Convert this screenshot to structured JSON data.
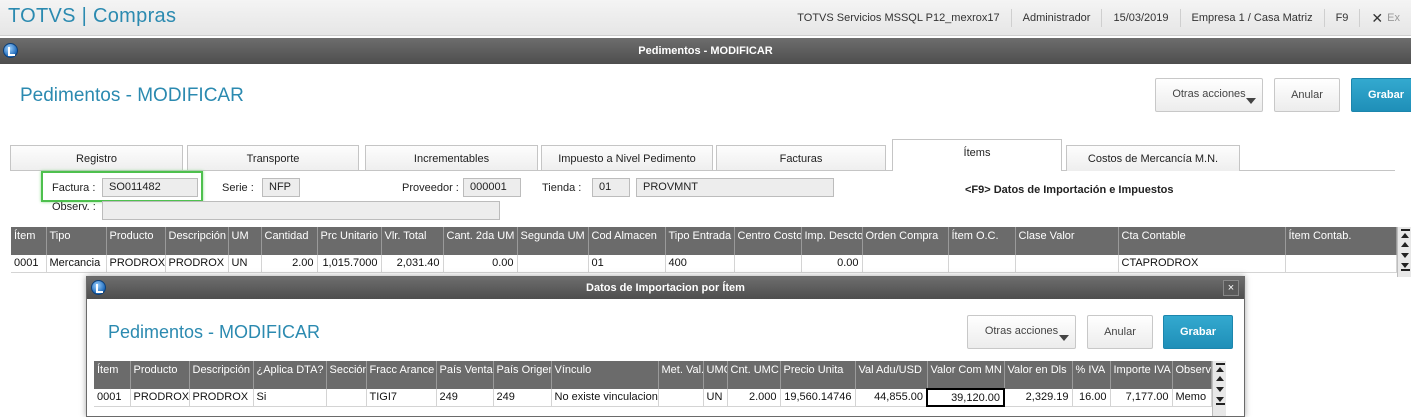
{
  "app": {
    "title": "TOTVS | Compras",
    "server": "TOTVS Servicios MSSQL P12_mexrox17",
    "user": "Administrador",
    "date": "15/03/2019",
    "company": "Empresa 1 / Casa Matriz",
    "help_key": "F9",
    "close_icon": "✕",
    "exit_label": "Ex"
  },
  "window": {
    "title": "Pedimentos - MODIFICAR",
    "form_title": "Pedimentos - MODIFICAR",
    "buttons": {
      "more": "Otras acciones",
      "cancel": "Anular",
      "save": "Grabar"
    }
  },
  "tabs": [
    {
      "label": "Registro"
    },
    {
      "label": "Transporte"
    },
    {
      "label": "Incrementables"
    },
    {
      "label": "Impuesto a Nivel Pedimento"
    },
    {
      "label": "Facturas"
    },
    {
      "label": "Ítems"
    },
    {
      "label": "Costos de Mercancía M.N."
    }
  ],
  "fields": {
    "factura_label": "Factura :",
    "factura_value": "SO011482",
    "serie_label": "Serie :",
    "serie_value": "NFP",
    "proveedor_label": "Proveedor :",
    "proveedor_value": "000001",
    "tienda_label": "Tienda :",
    "tienda_value": "01",
    "tienda_name": "PROVMNT",
    "observ_label": "Observ. :",
    "observ_value": "",
    "hint": "<F9> Datos de Importación e Impuestos"
  },
  "items_grid": {
    "columns": [
      "Ítem",
      "Tipo",
      "Producto",
      "Descripción",
      "UM",
      "Cantidad",
      "Prc Unitario",
      "Vlr. Total",
      "Cant. 2da UM",
      "Segunda UM",
      "Cod Almacen",
      "Tipo Entrada",
      "Centro Costo",
      "Imp. Descto.",
      "Orden Compra",
      "Ítem O.C.",
      "Clase Valor",
      "Cta Contable",
      "Ítem Contab."
    ],
    "rows": [
      [
        "0001",
        "Mercancia",
        "PRODROX",
        "PRODROX",
        "UN",
        "2.00",
        "1,015.7000",
        "2,031.40",
        "0.00",
        "",
        "01",
        "400",
        "",
        "0.00",
        "",
        "",
        "",
        "CTAPRODROX",
        ""
      ]
    ]
  },
  "dialog": {
    "title": "Datos de Importacion por Ítem",
    "close_icon": "×",
    "form_title": "Pedimentos - MODIFICAR",
    "buttons": {
      "more": "Otras acciones",
      "cancel": "Anular",
      "save": "Grabar"
    },
    "grid": {
      "columns": [
        "Ítem",
        "Producto",
        "Descripción",
        "¿Aplica DTA?",
        "Sección",
        "Fracc Arance",
        "País Venta",
        "País Origen",
        "Vínculo",
        "Met. Val.",
        "UMC",
        "Cnt. UMC",
        "Precio Unita",
        "Val Adu/USD",
        "Valor Com MN",
        "Valor en Dls",
        "% IVA",
        "Importe IVA",
        "Observ"
      ],
      "rows": [
        [
          "0001",
          "PRODROX",
          "PRODROX",
          "Si",
          "",
          "TIGI7",
          "249",
          "249",
          "No existe vinculacion",
          "",
          "UN",
          "2.000",
          "19,560.14746",
          "44,855.00",
          "39,120.00",
          "2,329.19",
          "16.00",
          "7,177.00",
          "Memo"
        ]
      ]
    }
  }
}
